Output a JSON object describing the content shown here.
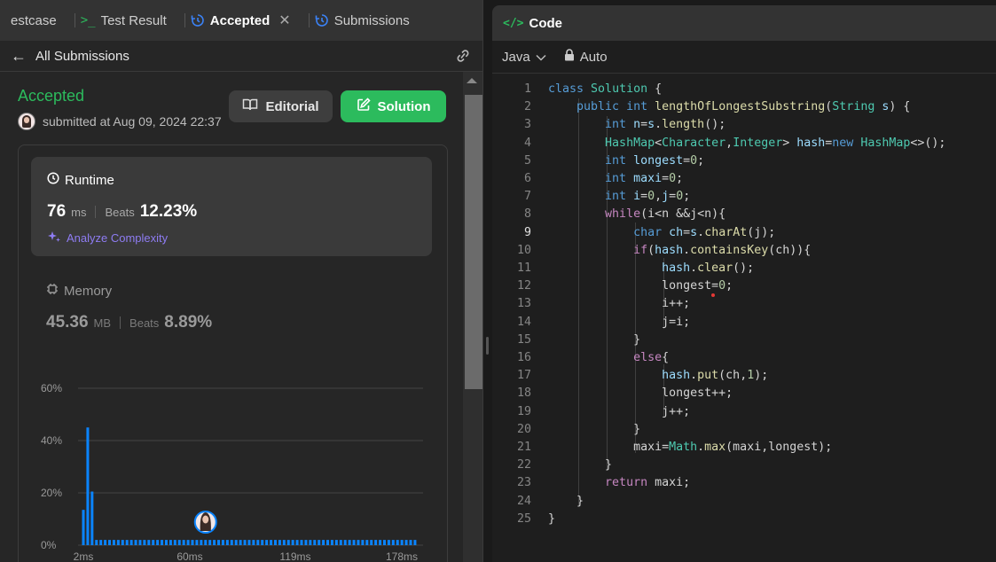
{
  "tabs": {
    "testcase": "estcase",
    "test_result": "Test Result",
    "accepted": "Accepted",
    "submissions": "Submissions"
  },
  "subheader": {
    "back_label": "All Submissions"
  },
  "submission": {
    "status": "Accepted",
    "submitted": "submitted at Aug 09, 2024 22:37",
    "editorial_label": "Editorial",
    "solution_label": "Solution"
  },
  "runtime": {
    "title": "Runtime",
    "value": "76",
    "unit": "ms",
    "beats_label": "Beats",
    "beats": "12.23%",
    "analyze": "Analyze Complexity"
  },
  "memory": {
    "title": "Memory",
    "value": "45.36",
    "unit": "MB",
    "beats_label": "Beats",
    "beats": "8.89%"
  },
  "chart_data": {
    "type": "bar",
    "y_ticks": [
      "60%",
      "40%",
      "20%",
      "0%"
    ],
    "x_ticks": [
      "2ms",
      "60ms",
      "119ms",
      "178ms"
    ],
    "ylim": [
      0,
      60
    ],
    "values": [
      13.5,
      45,
      20.5,
      2,
      2,
      2,
      2,
      2,
      2,
      2,
      2,
      2,
      2,
      2,
      2,
      2,
      2,
      2,
      2,
      2,
      2,
      2,
      2,
      2,
      2,
      2,
      2,
      2,
      2,
      2,
      2,
      2,
      2,
      2,
      2,
      2,
      2,
      2,
      2,
      2,
      2,
      2,
      2,
      2,
      2,
      2,
      2,
      2,
      2,
      2,
      2,
      2,
      2,
      2,
      2,
      2,
      2,
      2,
      2,
      2,
      2,
      2,
      2,
      2,
      2,
      2,
      2,
      2,
      2,
      2,
      2,
      2,
      2,
      2,
      2,
      2,
      2
    ],
    "user_bar_index": 28,
    "bar_color": "#0a84ff",
    "grid": true
  },
  "code": {
    "header": "Code",
    "language": "Java",
    "mode": "Auto",
    "current_line": 9,
    "lines": [
      [
        [
          "kw",
          "class"
        ],
        [
          "tx",
          " "
        ],
        [
          "ty",
          "Solution"
        ],
        [
          "tx",
          " {"
        ]
      ],
      [
        [
          "tx",
          "    "
        ],
        [
          "kw",
          "public"
        ],
        [
          "tx",
          " "
        ],
        [
          "kw",
          "int"
        ],
        [
          "tx",
          " "
        ],
        [
          "fn",
          "lengthOfLongestSubstring"
        ],
        [
          "tx",
          "("
        ],
        [
          "ty",
          "String"
        ],
        [
          "tx",
          " "
        ],
        [
          "vr",
          "s"
        ],
        [
          "tx",
          ") {"
        ]
      ],
      [
        [
          "tx",
          "        "
        ],
        [
          "kw",
          "int"
        ],
        [
          "tx",
          " "
        ],
        [
          "vr",
          "n"
        ],
        [
          "tx",
          "="
        ],
        [
          "vr",
          "s"
        ],
        [
          "tx",
          "."
        ],
        [
          "fn",
          "length"
        ],
        [
          "tx",
          "();"
        ]
      ],
      [
        [
          "tx",
          "        "
        ],
        [
          "ty",
          "HashMap"
        ],
        [
          "tx",
          "<"
        ],
        [
          "ty",
          "Character"
        ],
        [
          "tx",
          ","
        ],
        [
          "ty",
          "Integer"
        ],
        [
          "tx",
          "> "
        ],
        [
          "vr",
          "hash"
        ],
        [
          "tx",
          "="
        ],
        [
          "kw",
          "new"
        ],
        [
          "tx",
          " "
        ],
        [
          "ty",
          "HashMap"
        ],
        [
          "tx",
          "<>();"
        ]
      ],
      [
        [
          "tx",
          "        "
        ],
        [
          "kw",
          "int"
        ],
        [
          "tx",
          " "
        ],
        [
          "vr",
          "longest"
        ],
        [
          "tx",
          "="
        ],
        [
          "nm",
          "0"
        ],
        [
          "tx",
          ";"
        ]
      ],
      [
        [
          "tx",
          "        "
        ],
        [
          "kw",
          "int"
        ],
        [
          "tx",
          " "
        ],
        [
          "vr",
          "maxi"
        ],
        [
          "tx",
          "="
        ],
        [
          "nm",
          "0"
        ],
        [
          "tx",
          ";"
        ]
      ],
      [
        [
          "tx",
          "        "
        ],
        [
          "kw",
          "int"
        ],
        [
          "tx",
          " "
        ],
        [
          "vr",
          "i"
        ],
        [
          "tx",
          "="
        ],
        [
          "nm",
          "0"
        ],
        [
          "tx",
          ","
        ],
        [
          "vr",
          "j"
        ],
        [
          "tx",
          "="
        ],
        [
          "nm",
          "0"
        ],
        [
          "tx",
          ";"
        ]
      ],
      [
        [
          "tx",
          "        "
        ],
        [
          "ctl",
          "while"
        ],
        [
          "tx",
          "(i<n &&j<n){"
        ]
      ],
      [
        [
          "tx",
          "            "
        ],
        [
          "kw",
          "char"
        ],
        [
          "tx",
          " "
        ],
        [
          "vr",
          "ch"
        ],
        [
          "tx",
          "="
        ],
        [
          "vr",
          "s"
        ],
        [
          "tx",
          "."
        ],
        [
          "fn",
          "charAt"
        ],
        [
          "tx",
          "(j);"
        ]
      ],
      [
        [
          "tx",
          "            "
        ],
        [
          "ctl",
          "if"
        ],
        [
          "tx",
          "("
        ],
        [
          "vr",
          "hash"
        ],
        [
          "tx",
          "."
        ],
        [
          "fn",
          "containsKey"
        ],
        [
          "tx",
          "(ch)){"
        ]
      ],
      [
        [
          "tx",
          "                "
        ],
        [
          "vr",
          "hash"
        ],
        [
          "tx",
          "."
        ],
        [
          "fn",
          "clear"
        ],
        [
          "tx",
          "();"
        ]
      ],
      [
        [
          "tx",
          "                longest="
        ],
        [
          "nm",
          "0"
        ],
        [
          "tx",
          ";"
        ]
      ],
      [
        [
          "tx",
          "                i++;"
        ]
      ],
      [
        [
          "tx",
          "                j=i;"
        ]
      ],
      [
        [
          "tx",
          "            }"
        ]
      ],
      [
        [
          "tx",
          "            "
        ],
        [
          "ctl",
          "else"
        ],
        [
          "tx",
          "{"
        ]
      ],
      [
        [
          "tx",
          "                "
        ],
        [
          "vr",
          "hash"
        ],
        [
          "tx",
          "."
        ],
        [
          "fn",
          "put"
        ],
        [
          "tx",
          "(ch,"
        ],
        [
          "nm",
          "1"
        ],
        [
          "tx",
          ");"
        ]
      ],
      [
        [
          "tx",
          "                longest++;"
        ]
      ],
      [
        [
          "tx",
          "                j++;"
        ]
      ],
      [
        [
          "tx",
          "            }"
        ]
      ],
      [
        [
          "tx",
          "            maxi="
        ],
        [
          "ty",
          "Math"
        ],
        [
          "tx",
          "."
        ],
        [
          "fn",
          "max"
        ],
        [
          "tx",
          "(maxi,longest);"
        ]
      ],
      [
        [
          "tx",
          "        }"
        ]
      ],
      [
        [
          "tx",
          "        "
        ],
        [
          "ctl",
          "return"
        ],
        [
          "tx",
          " maxi;"
        ]
      ],
      [
        [
          "tx",
          "    }"
        ]
      ],
      [
        [
          "tx",
          "}"
        ]
      ]
    ]
  }
}
